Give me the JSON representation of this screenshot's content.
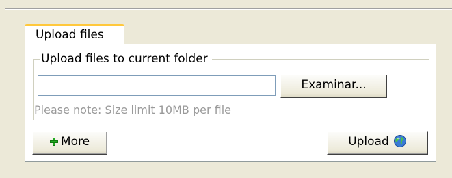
{
  "tab": {
    "label": "Upload files"
  },
  "section": {
    "legend": "Upload files to current folder"
  },
  "file_input": {
    "value": "",
    "browse_label": "Examinar..."
  },
  "note": "Please note: Size limit 10MB per file",
  "buttons": {
    "more_label": "More",
    "more_icon": "plus-icon",
    "upload_label": "Upload",
    "upload_icon": "globe-icon"
  },
  "colors": {
    "tab_accent": "#ffc83c",
    "background": "#ece9d8",
    "note_text": "#9a9a9a",
    "plus_green": "#22aa22"
  }
}
